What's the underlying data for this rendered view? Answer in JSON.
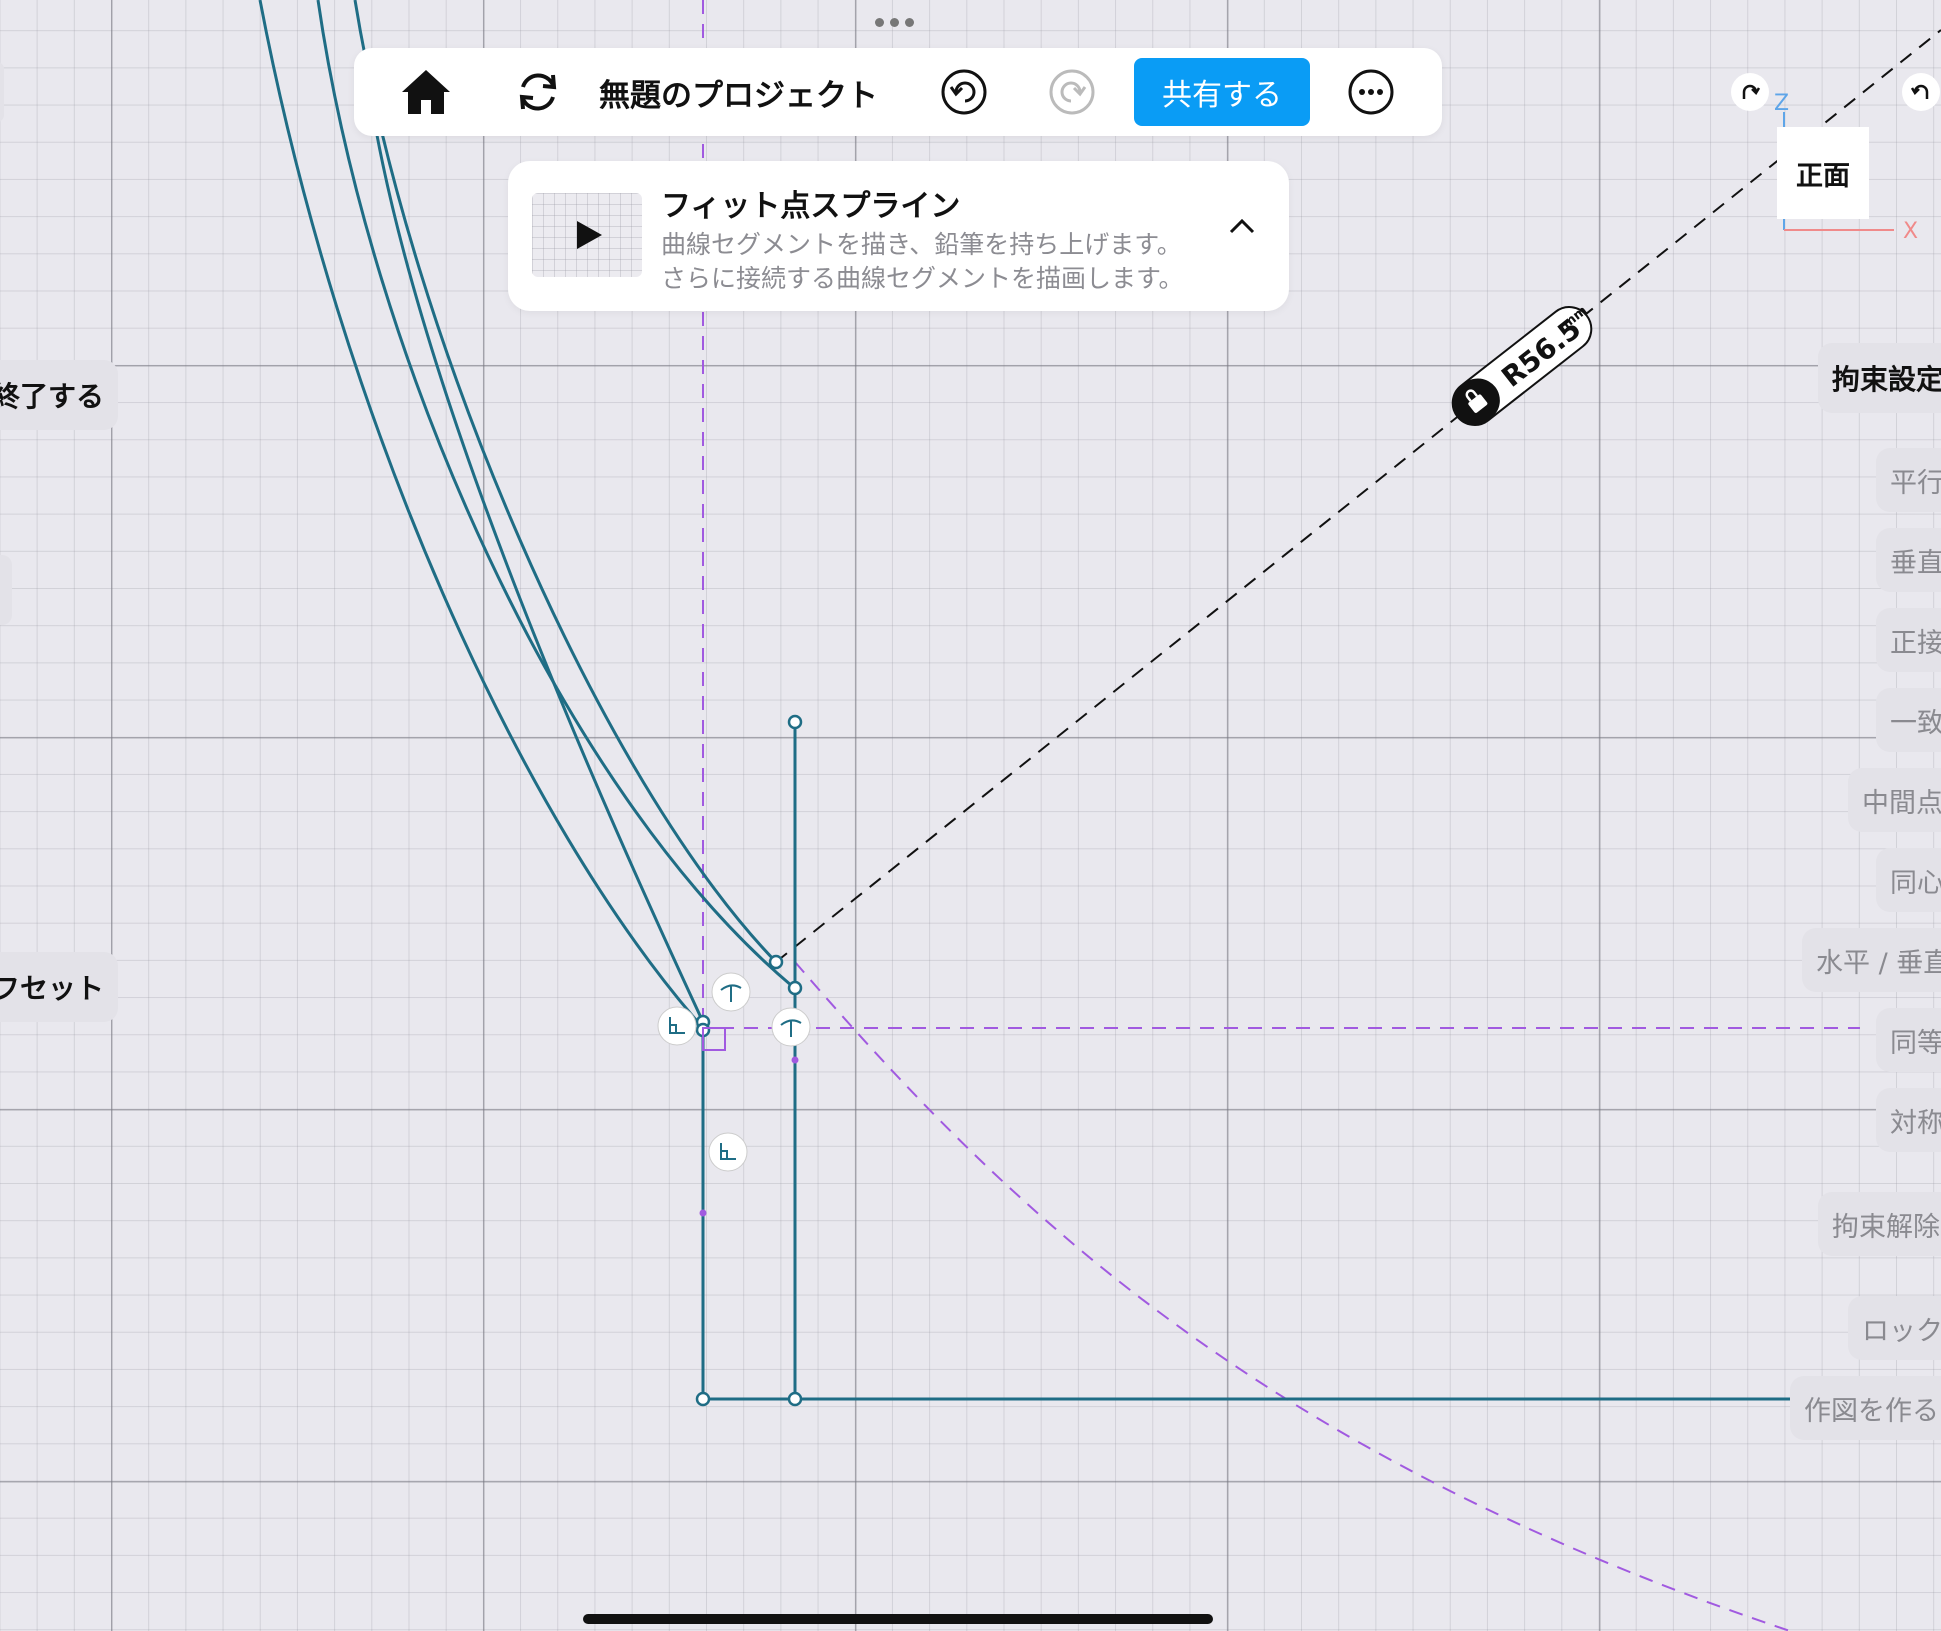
{
  "toolbar": {
    "project_title": "無題のプロジェクト",
    "share_label": "共有する"
  },
  "tip": {
    "title": "フィット点スプライン",
    "line1": "曲線セグメントを描き、鉛筆を持ち上げます。",
    "line2": "さらに接続する曲線セグメントを描画します。"
  },
  "dimension": {
    "label": "R56.5",
    "unit": "mm"
  },
  "view_cube": {
    "face_label": "正面",
    "axis_z": "Z",
    "axis_x": "X"
  },
  "left_panel": {
    "finish_label": "終了する",
    "offset_label": "フセット"
  },
  "constraints": {
    "title": "拘束設定",
    "items": [
      "平行",
      "垂直",
      "正接",
      "一致",
      "中間点",
      "同心",
      "水平 / 垂直",
      "同等",
      "対称"
    ],
    "unconstrain": "拘束解除",
    "lock": "ロック",
    "construction": "作図を作る"
  },
  "colors": {
    "sketch_line": "#1f6d85",
    "construction": "#a15ae0",
    "accent": "#0a9cf5"
  }
}
